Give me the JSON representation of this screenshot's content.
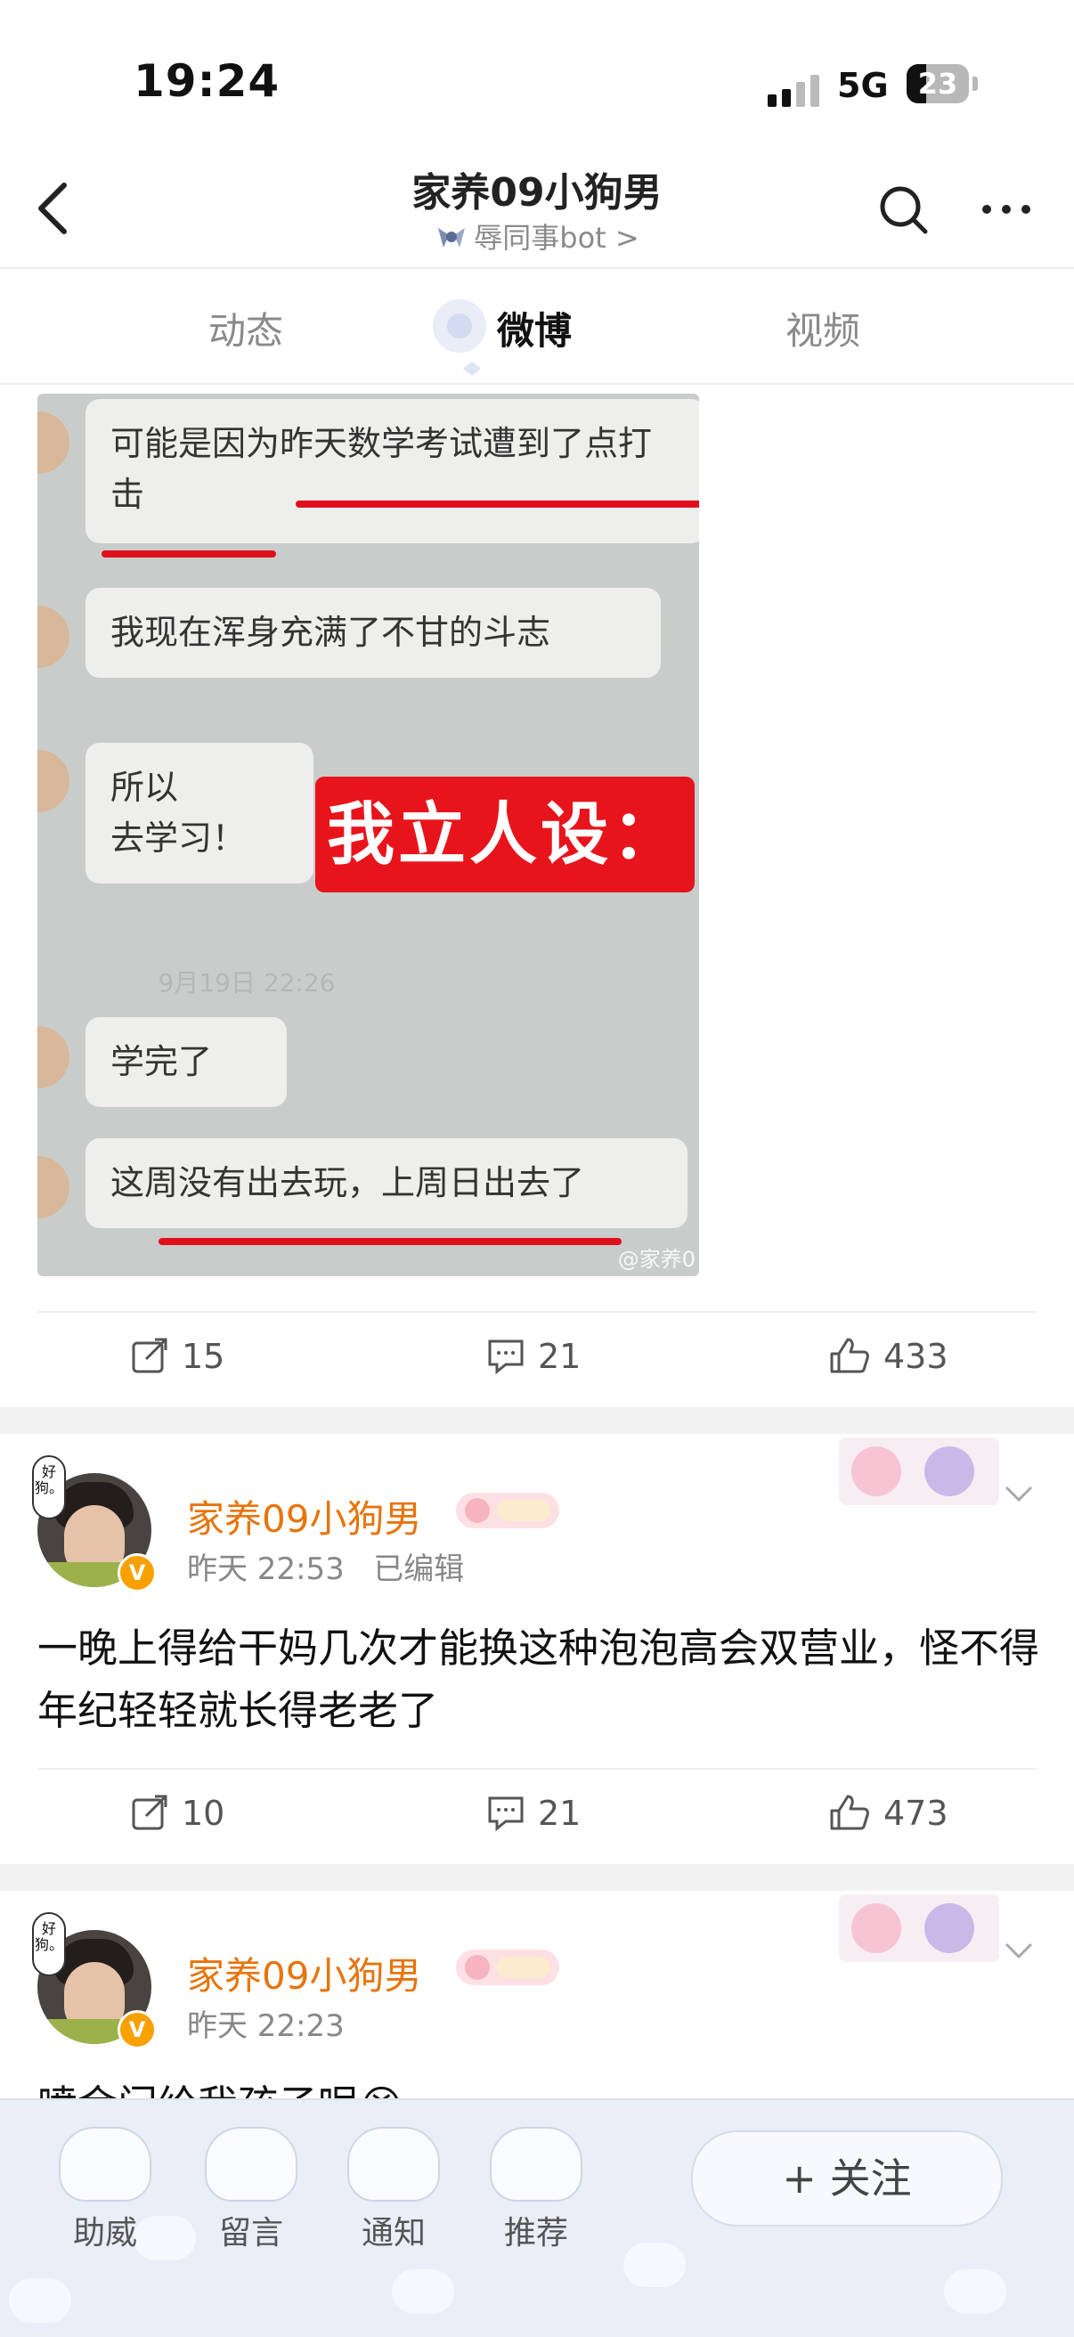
{
  "status_bar": {
    "time": "19:24",
    "network": "5G",
    "battery": "23"
  },
  "header": {
    "title": "家养09小狗男",
    "subtitle": "辱同事bot >"
  },
  "tabs": [
    {
      "label": "动态"
    },
    {
      "label": "微博"
    },
    {
      "label": "视频"
    }
  ],
  "post_image": {
    "bubbles": [
      "可能是因为昨天数学考试遭到了点打击",
      "我现在浑身充满了不甘的斗志",
      "所以\n去学习！",
      "学完了",
      "这周没有出去玩，上周日出去了"
    ],
    "overlay_tag": "我立人设：",
    "chat_time": "9月19日 22:26",
    "watermark": "@家养0"
  },
  "post1_actions": {
    "reposts": "15",
    "comments": "21",
    "likes": "433"
  },
  "posts": [
    {
      "avatar_tag": "好狗。",
      "author": "家养09小狗男",
      "time": "昨天 22:53",
      "edited": "已编辑",
      "text": "一晚上得给干妈几次才能换这种泡泡高会双营业，怪不得年纪轻轻就长得老老了",
      "reposts": "10",
      "comments": "21",
      "likes": "473"
    },
    {
      "avatar_tag": "好狗。",
      "author": "家养09小狗男",
      "time": "昨天 22:23",
      "text": "喷金门给我孩子呢😭"
    }
  ],
  "bottom_bar": {
    "items": [
      {
        "label": "助威"
      },
      {
        "label": "留言"
      },
      {
        "label": "通知"
      },
      {
        "label": "推荐"
      }
    ],
    "follow": "+ 关注"
  },
  "colors": {
    "accent": "#e8740c",
    "red": "#e8141c",
    "verify": "#f7a100"
  }
}
